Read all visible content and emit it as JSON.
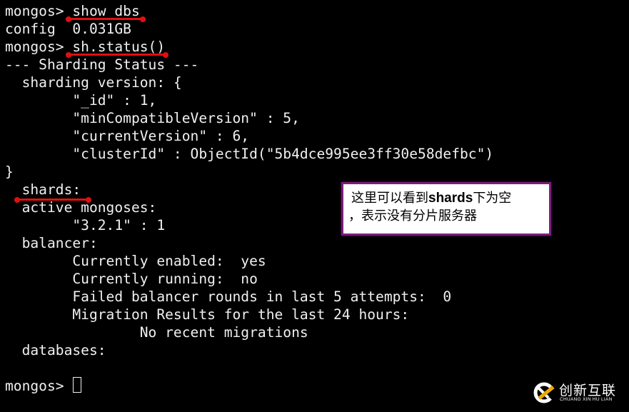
{
  "terminal": {
    "lines": [
      "mongos> show dbs",
      "config  0.031GB",
      "mongos> sh.status()",
      "--- Sharding Status ---",
      "  sharding version: {",
      "        \"_id\" : 1,",
      "        \"minCompatibleVersion\" : 5,",
      "        \"currentVersion\" : 6,",
      "        \"clusterId\" : ObjectId(\"5b4dce995ee3ff30e58defbc\")",
      "}",
      "  shards:",
      "  active mongoses:",
      "        \"3.2.1\" : 1",
      "  balancer:",
      "        Currently enabled:  yes",
      "        Currently running:  no",
      "        Failed balancer rounds in last 5 attempts:  0",
      "        Migration Results for the last 24 hours:",
      "                No recent migrations",
      "  databases:",
      "",
      "mongos> "
    ],
    "annotation_color": "#e01010"
  },
  "callout": {
    "line1_prefix": "这里可以看到",
    "line1_bold": "shards",
    "line1_suffix": "下为空",
    "line2": "，表示没有分片服务器",
    "border_color": "#7a1f7a"
  },
  "logo": {
    "name_cn": "创新互联",
    "name_en": "CHUANG XIN HU LIAN",
    "icon": "chuangxin-logo-icon"
  }
}
